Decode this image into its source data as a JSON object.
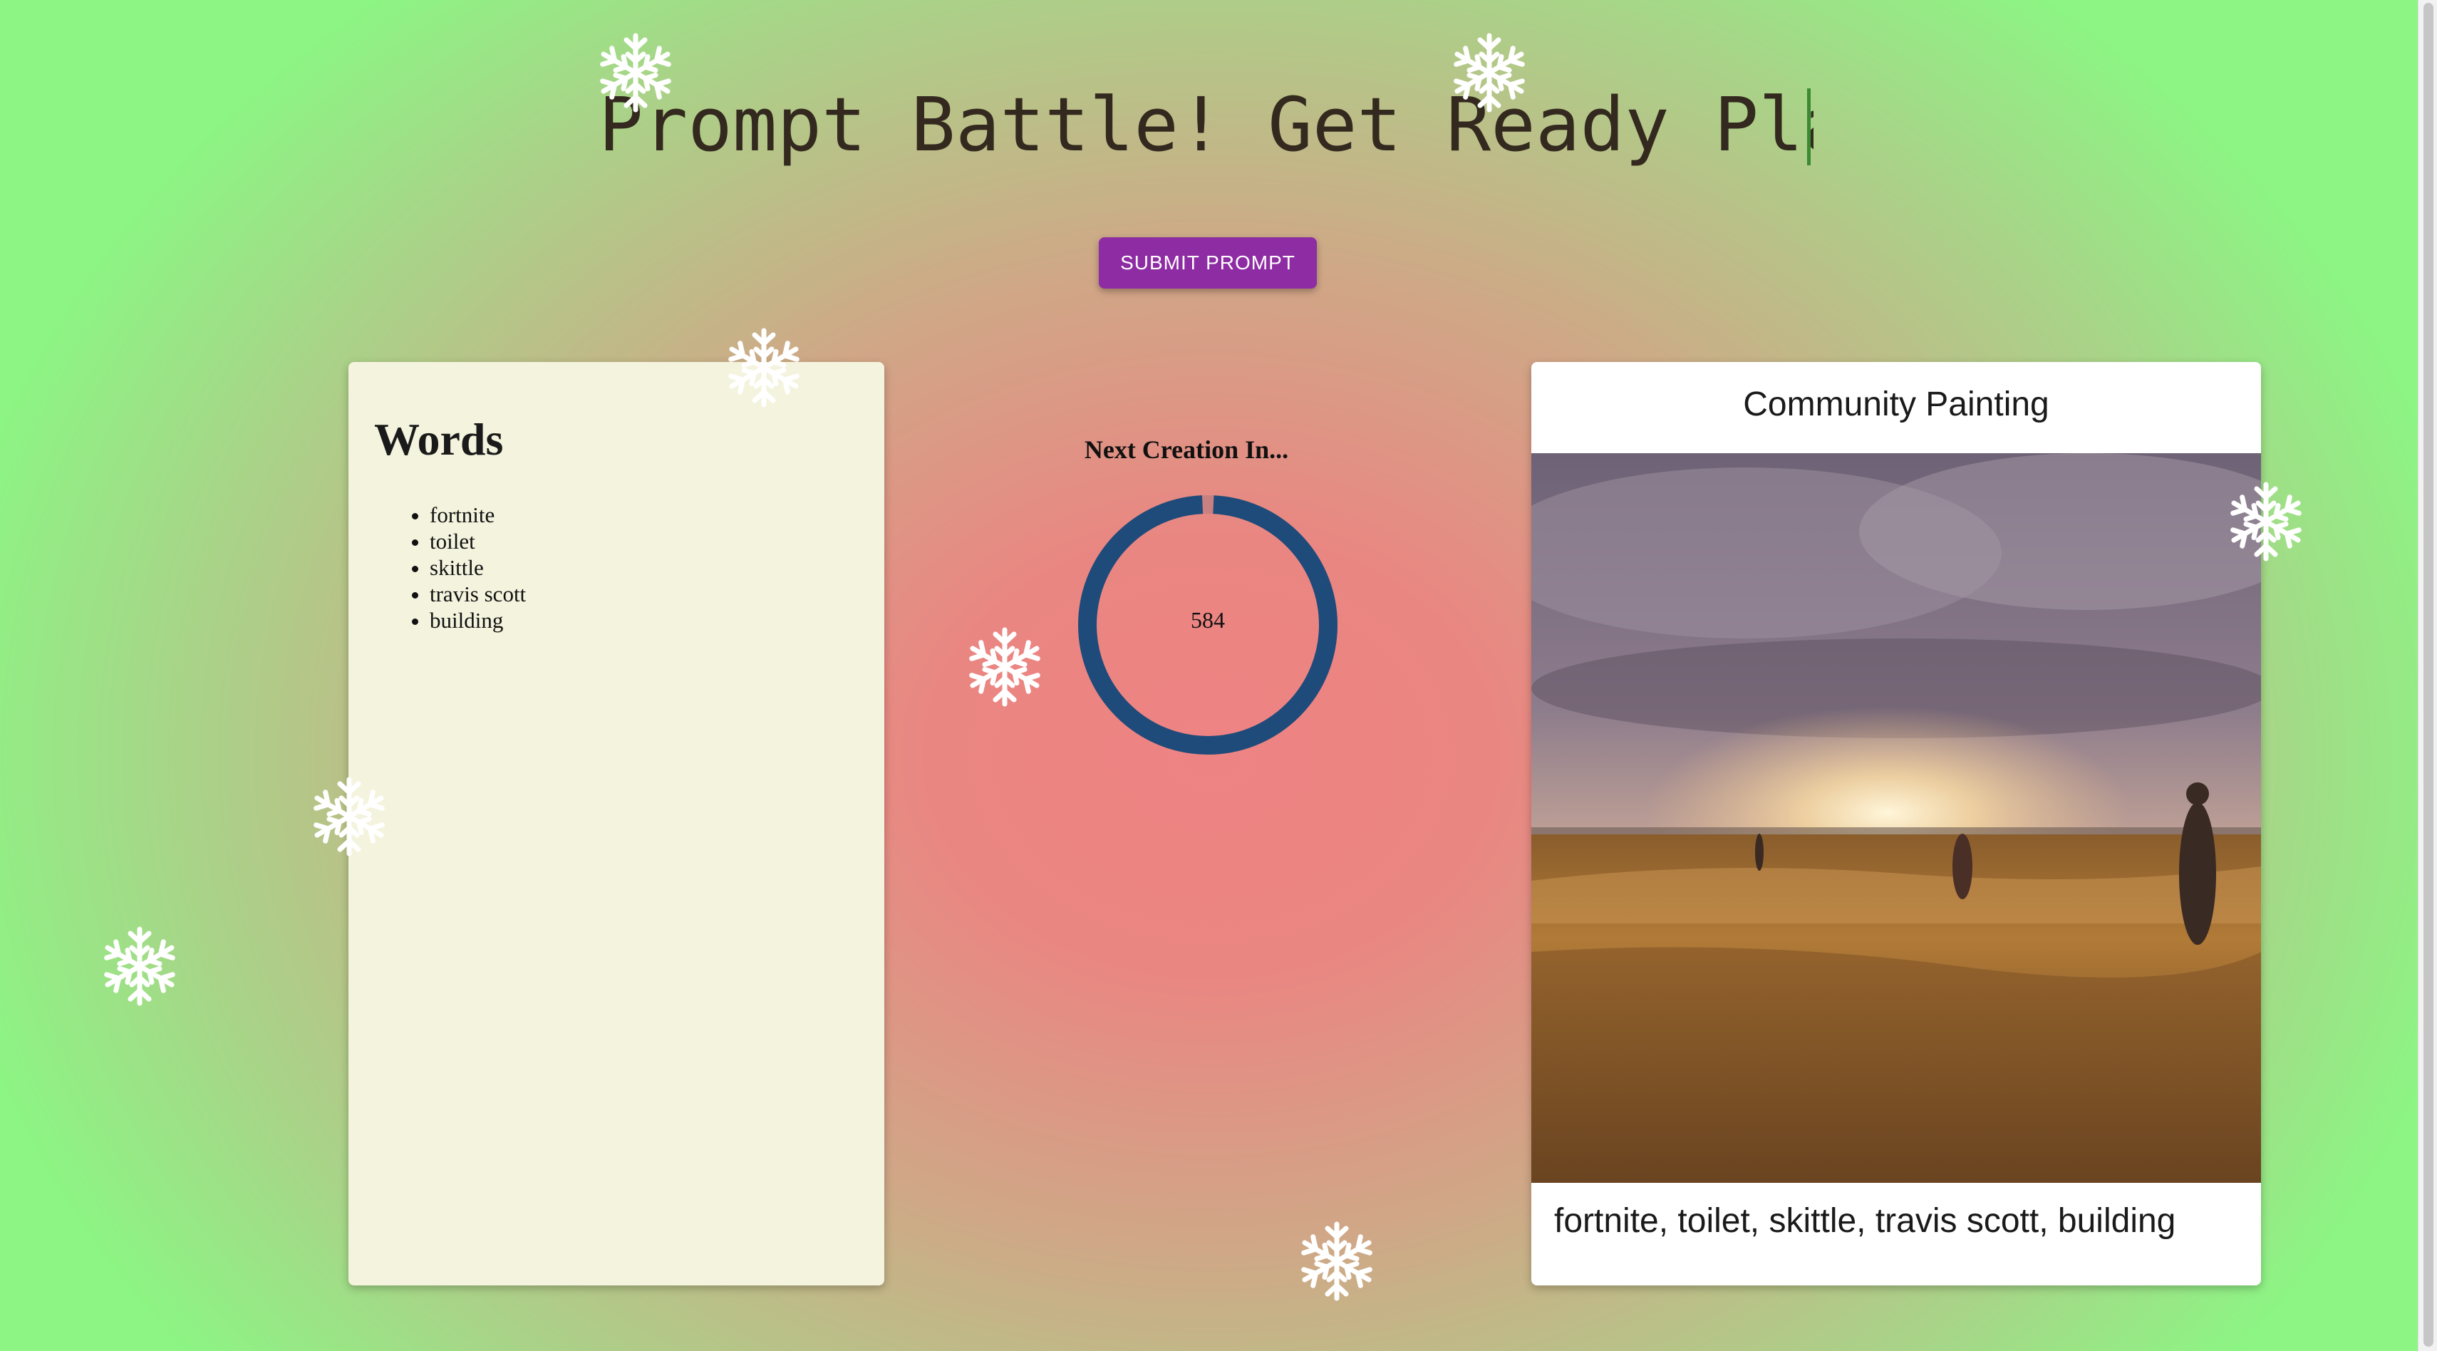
{
  "header": {
    "title": "Prompt Battle! Get Ready Play"
  },
  "actions": {
    "submit_label": "SUBMIT PROMPT"
  },
  "words_panel": {
    "heading": "Words",
    "items": [
      "fortnite",
      "toilet",
      "skittle",
      "travis scott",
      "building"
    ]
  },
  "timer": {
    "label": "Next Creation In...",
    "value": "584",
    "ring_fraction": 0.985
  },
  "painting_panel": {
    "title": "Community Painting",
    "caption": "fortnite, toilet, skittle, travis scott, building"
  },
  "colors": {
    "accent": "#8e2ca3",
    "ring": "#1f4b7a",
    "words_card": "#f4f3de",
    "title_text": "#33291f"
  },
  "icons": [
    "snowflake-icon",
    "cursor-caret"
  ]
}
